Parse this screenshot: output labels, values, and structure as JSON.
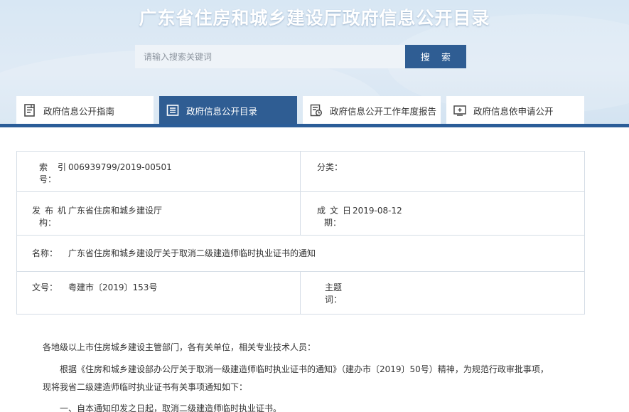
{
  "header": {
    "title": "广东省住房和城乡建设厅政府信息公开目录",
    "search_placeholder": "请输入搜索关键词",
    "search_button": "搜 索"
  },
  "tabs": [
    {
      "label": "政府信息公开指南",
      "icon": "document-list-icon",
      "active": false
    },
    {
      "label": "政府信息公开目录",
      "icon": "directory-icon",
      "active": true
    },
    {
      "label": "政府信息公开工作年度报告",
      "icon": "report-icon",
      "active": false
    },
    {
      "label": "政府信息依申请公开",
      "icon": "application-icon",
      "active": false
    }
  ],
  "meta": {
    "index_label_1": "索引",
    "index_label_2": "号：",
    "index_value": "006939799/2019-00501",
    "category_label": "分类：",
    "category_value": "",
    "publisher_label_1": "发布机",
    "publisher_label_2": "构：",
    "publisher_value": "广东省住房和城乡建设厅",
    "date_label_1": "成文日",
    "date_label_2": "期：",
    "date_value": "2019-08-12",
    "name_label": "名称：",
    "name_value": "广东省住房和城乡建设厅关于取消二级建造师临时执业证书的通知",
    "docno_label": "文号：",
    "docno_value": "粤建市〔2019〕153号",
    "subject_label_1": "主题",
    "subject_label_2": "词：",
    "subject_value": ""
  },
  "content": {
    "salutation": "各地级以上市住房城乡建设主管部门，各有关单位，相关专业技术人员：",
    "para1_line1": "根据《住房和城乡建设部办公厅关于取消一级建造师临时执业证书的通知》（建办市〔2019〕50号）精神，为规范行政审批事项，",
    "para1_line2": "现将我省二级建造师临时执业证书有关事项通知如下：",
    "item1": "一、自本通知印发之日起，取消二级建造师临时执业证书。"
  },
  "colors": {
    "primary": "#2f5d93",
    "banner": "#d8e7f4",
    "border": "#d5dde6"
  }
}
